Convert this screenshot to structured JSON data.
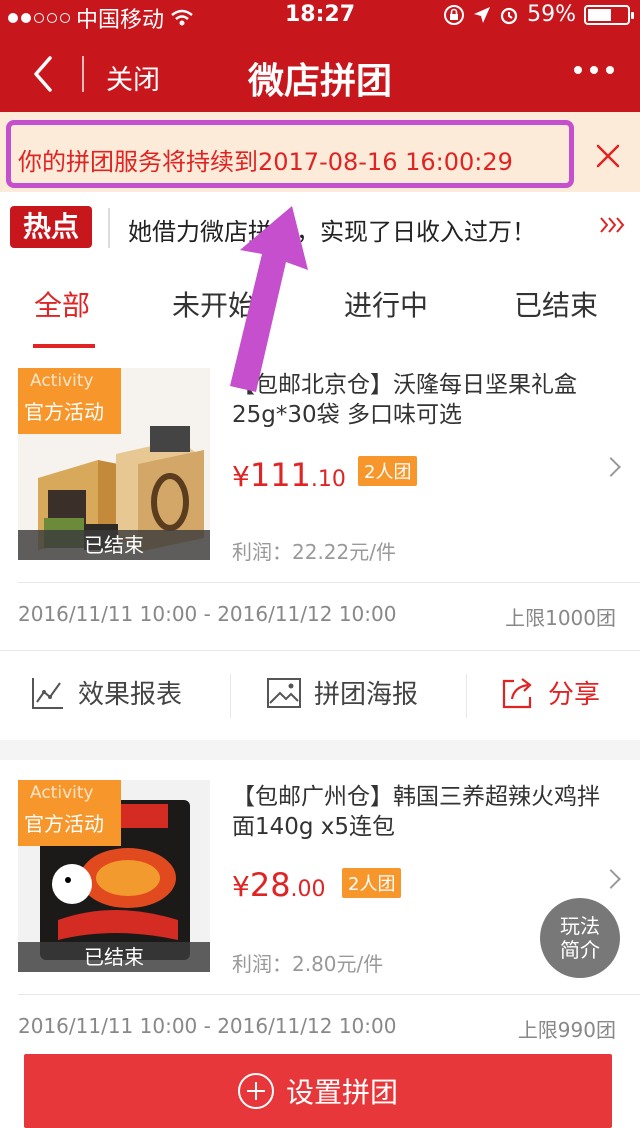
{
  "status_bar": {
    "carrier": "中国移动",
    "time": "18:27",
    "battery": "59%"
  },
  "nav": {
    "close_label": "关闭",
    "title": "微店拼团"
  },
  "notice": {
    "text": "你的拼团服务将持续到2017-08-16 16:00:29"
  },
  "hot": {
    "badge": "热点",
    "text": "她借力微店拼团，实现了日收入过万！"
  },
  "tabs": [
    {
      "label": "全部",
      "active": true
    },
    {
      "label": "未开始",
      "active": false
    },
    {
      "label": "进行中",
      "active": false
    },
    {
      "label": "已结束",
      "active": false
    }
  ],
  "products": [
    {
      "tag_en": "Activity",
      "tag_cn": "官方活动",
      "status": "已结束",
      "title": "【包邮北京仓】沃隆每日坚果礼盒25g*30袋 多口味可选",
      "price_symbol": "¥",
      "price_int": "111",
      "price_dec": ".10",
      "group_size": "2人团",
      "profit": "利润：22.22元/件",
      "date_range": "2016/11/11 10:00 - 2016/11/12 10:00",
      "limit": "上限1000团"
    },
    {
      "tag_en": "Activity",
      "tag_cn": "官方活动",
      "status": "已结束",
      "title": "【包邮广州仓】韩国三养超辣火鸡拌面140g x5连包",
      "price_symbol": "¥",
      "price_int": "28",
      "price_dec": ".00",
      "group_size": "2人团",
      "profit": "利润：2.80元/件",
      "date_range": "2016/11/11 10:00 - 2016/11/12 10:00",
      "limit": "上限990团"
    }
  ],
  "actions": {
    "report": "效果报表",
    "poster": "拼团海报",
    "share": "分享"
  },
  "float_help": {
    "line1": "玩法",
    "line2": "简介"
  },
  "bottom_button": "设置拼团",
  "colors": {
    "brand_red": "#c8161d",
    "accent_red": "#e02424",
    "orange": "#f7962a",
    "notice_bg": "#fcebd9",
    "annotation": "#c54fcc"
  }
}
